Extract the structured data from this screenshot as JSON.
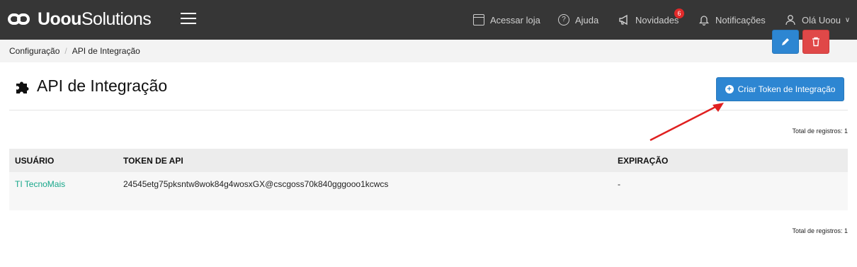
{
  "brand": {
    "bold": "Uoou",
    "regular": "Solutions"
  },
  "nav": {
    "store": "Acessar loja",
    "help": "Ajuda",
    "news": "Novidades",
    "news_badge": "6",
    "notifications": "Notificações",
    "user": "Olá Uoou"
  },
  "breadcrumb": {
    "items": [
      "Configuração",
      "API de Integração"
    ]
  },
  "page": {
    "title": "API de Integração",
    "create_button": "Criar Token de Integração",
    "total_top": "Total de registros: 1",
    "total_bottom": "Total de registros: 1"
  },
  "table": {
    "headers": [
      "USUÁRIO",
      "TOKEN DE API",
      "EXPIRAÇÃO"
    ],
    "rows": [
      {
        "user": "TI TecnoMais",
        "token": "24545etg75pksntw8wok84g4wosxGX@cscgoss70k840gggooo1kcwcs",
        "expiration": "-"
      }
    ]
  },
  "colors": {
    "topbar": "#363636",
    "primary": "#2d86d2",
    "danger": "#e04848",
    "link": "#17a78a",
    "badge": "#e12a2a",
    "annotation": "#e02020"
  },
  "icons": [
    "logo-mark",
    "menu-icon",
    "store-icon",
    "help-icon",
    "megaphone-icon",
    "bell-icon",
    "user-icon",
    "puzzle-icon",
    "plus-circle-icon",
    "pencil-icon",
    "trash-icon"
  ]
}
